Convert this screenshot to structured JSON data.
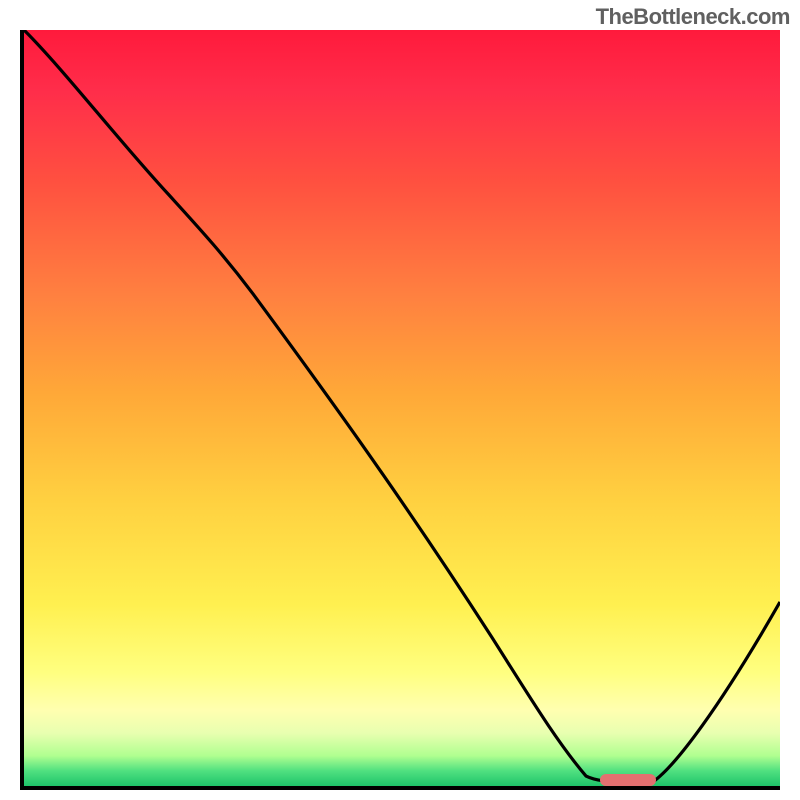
{
  "watermark": "TheBottleneck.com",
  "chart_data": {
    "type": "line",
    "title": "",
    "xlabel": "",
    "ylabel": "",
    "xlim": [
      0,
      100
    ],
    "ylim": [
      0,
      100
    ],
    "grid": false,
    "series": [
      {
        "name": "curve",
        "x": [
          0,
          10,
          20,
          30,
          40,
          50,
          60,
          70,
          75,
          80,
          82,
          90,
          100
        ],
        "y": [
          100,
          92,
          84,
          74,
          62,
          50,
          38,
          20,
          8,
          0.5,
          0.5,
          10,
          25
        ]
      }
    ],
    "marker": {
      "x_start": 76,
      "x_end": 83,
      "y": 0.6,
      "color": "#e37070"
    },
    "gradient_stops": [
      {
        "pos": 0.0,
        "color": "#ff1a3c"
      },
      {
        "pos": 0.5,
        "color": "#ffb040"
      },
      {
        "pos": 0.85,
        "color": "#ffff80"
      },
      {
        "pos": 1.0,
        "color": "#1ec46a"
      }
    ]
  }
}
